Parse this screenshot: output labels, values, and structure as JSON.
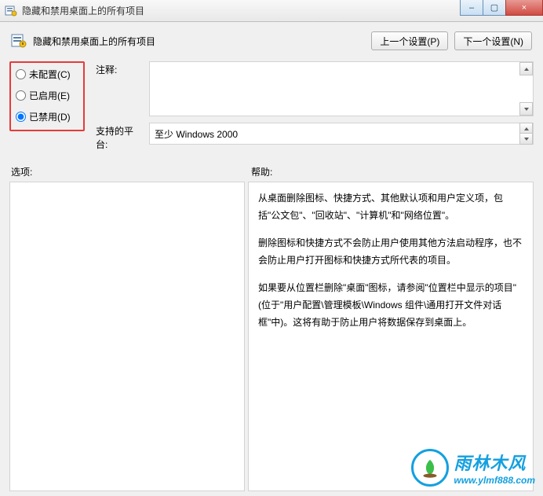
{
  "window": {
    "title": "隐藏和禁用桌面上的所有项目",
    "min_btn": "–",
    "max_btn": "▢",
    "close_btn": "×"
  },
  "header": {
    "policy_title": "隐藏和禁用桌面上的所有项目",
    "prev_btn": "上一个设置(P)",
    "next_btn": "下一个设置(N)"
  },
  "radios": {
    "not_configured": "未配置(C)",
    "enabled": "已启用(E)",
    "disabled": "已禁用(D)",
    "selected": "disabled"
  },
  "fields": {
    "comment_label": "注释:",
    "comment_value": "",
    "platform_label": "支持的平台:",
    "platform_value": "至少 Windows 2000"
  },
  "section_labels": {
    "options": "选项:",
    "help": "帮助:"
  },
  "help": {
    "p1": "从桌面删除图标、快捷方式、其他默认项和用户定义项，包括\"公文包\"、\"回收站\"、\"计算机\"和\"网络位置\"。",
    "p2": "删除图标和快捷方式不会防止用户使用其他方法启动程序，也不会防止用户打开图标和快捷方式所代表的项目。",
    "p3": "如果要从位置栏删除\"桌面\"图标，请参阅\"位置栏中显示的项目\"(位于\"用户配置\\管理模板\\Windows 组件\\通用打开文件对话框\"中)。这将有助于防止用户将数据保存到桌面上。"
  },
  "watermark": {
    "name": "雨林木风",
    "url": "www.ylmf888.com"
  }
}
